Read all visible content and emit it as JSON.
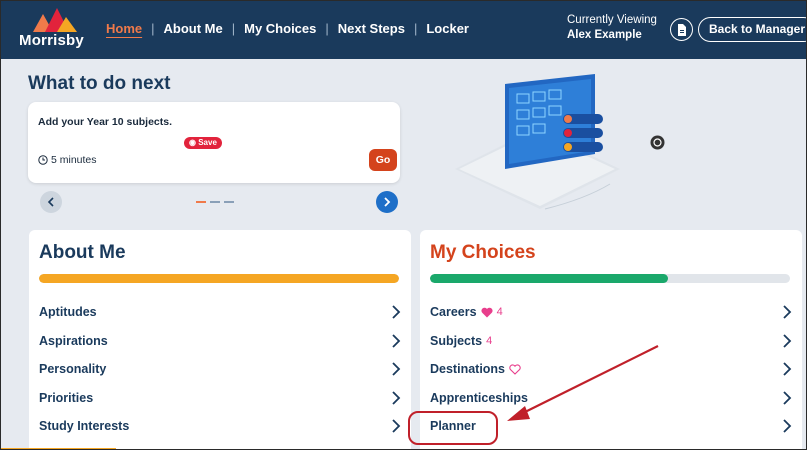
{
  "header": {
    "logo_text": "Morrisby",
    "nav": [
      {
        "label": "Home",
        "active": true
      },
      {
        "label": "About Me",
        "active": false
      },
      {
        "label": "My Choices",
        "active": false
      },
      {
        "label": "Next Steps",
        "active": false
      },
      {
        "label": "Locker",
        "active": false
      }
    ],
    "viewing_label": "Currently Viewing",
    "viewing_name": "Alex Example",
    "back_label": "Back to Manager"
  },
  "next": {
    "title": "What to do next",
    "task_title": "Add your Year 10 subjects.",
    "save_label": "Save",
    "time": "5 minutes",
    "go_label": "Go",
    "dots_total": 3,
    "dots_active": 0
  },
  "about": {
    "title": "About Me",
    "progress": 1.0,
    "items": [
      "Aptitudes",
      "Aspirations",
      "Personality",
      "Priorities",
      "Study Interests"
    ]
  },
  "choices": {
    "title": "My Choices",
    "progress": 0.66,
    "items": [
      {
        "label": "Careers",
        "icon": "heart-filled-icon",
        "count": "4"
      },
      {
        "label": "Subjects",
        "icon": "",
        "count": "4"
      },
      {
        "label": "Destinations",
        "icon": "heart-outline-icon",
        "count": ""
      },
      {
        "label": "Apprenticeships",
        "icon": "",
        "count": ""
      },
      {
        "label": "Planner",
        "icon": "",
        "count": ""
      }
    ]
  },
  "colors": {
    "nav_bg": "#1a3a5c",
    "accent_orange": "#f07a4a",
    "go_red": "#d4431c",
    "about_progress": "#f5a623",
    "choices_progress": "#1aa86b",
    "heart_pink": "#e83e8c",
    "annotation_red": "#c0202a"
  }
}
